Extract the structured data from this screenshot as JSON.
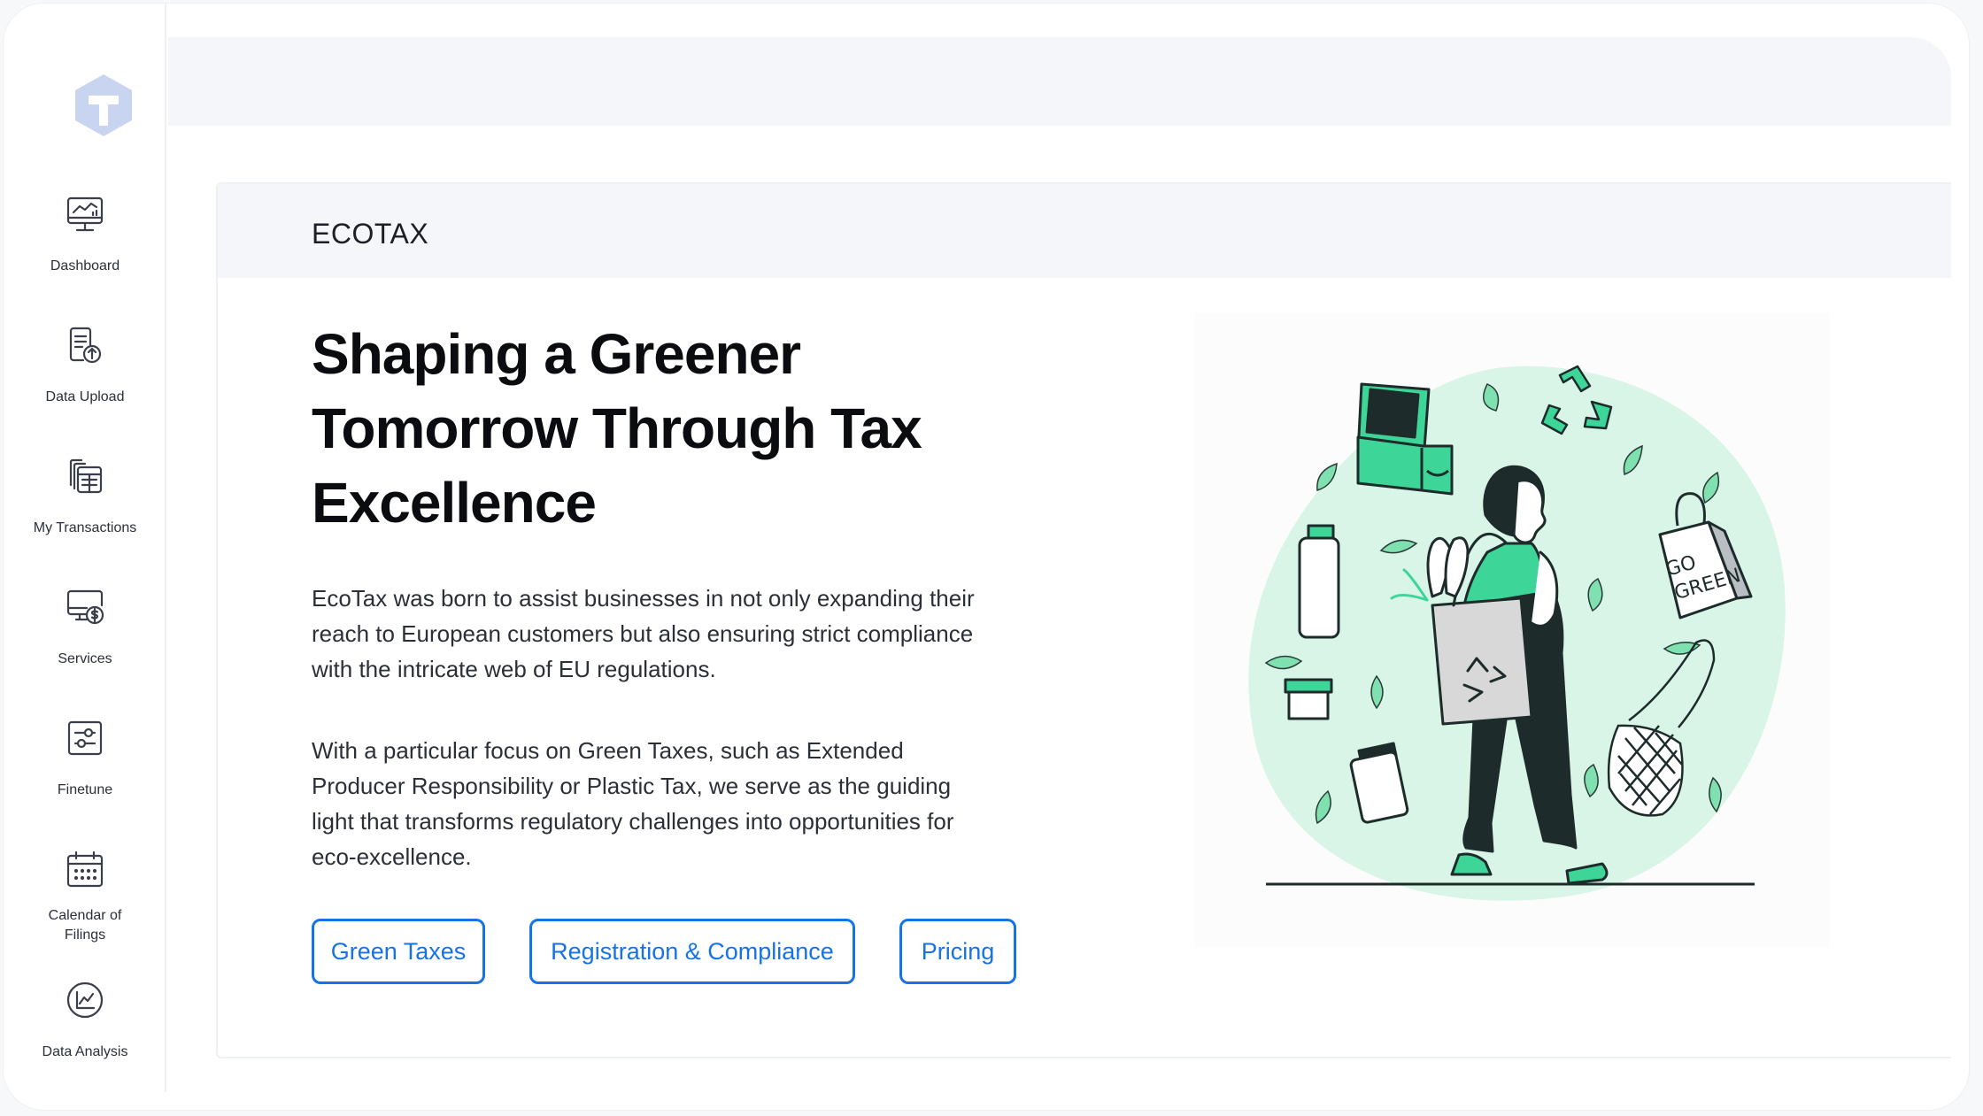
{
  "sidebar": {
    "items": [
      {
        "label": "Dashboard",
        "icon": "monitor-chart-icon"
      },
      {
        "label": "Data Upload",
        "icon": "document-upload-icon"
      },
      {
        "label": "My Transactions",
        "icon": "files-table-icon"
      },
      {
        "label": "Services",
        "icon": "monitor-dollar-icon"
      },
      {
        "label": "Finetune",
        "icon": "sliders-icon"
      },
      {
        "label": "Calendar of\nFilings",
        "label_line1": "Calendar of",
        "label_line2": "Filings",
        "icon": "calendar-icon"
      },
      {
        "label": "Data Analysis",
        "icon": "analytics-circle-icon"
      }
    ]
  },
  "card": {
    "title": "ECOTAX",
    "headline": "Shaping a Greener Tomorrow Through Tax Excellence",
    "paragraph1": "EcoTax was born to assist businesses in not only expanding their reach to European customers but also ensuring strict compliance with the intricate web of EU regulations.",
    "paragraph2": "With a particular focus on Green Taxes, such as Extended Producer Responsibility or Plastic Tax, we serve as the guiding light that transforms regulatory challenges into opportunities for eco-excellence.",
    "buttons": {
      "green_taxes": "Green Taxes",
      "registration": "Registration & Compliance",
      "pricing": "Pricing"
    },
    "illustration_text": "GO GREEN"
  },
  "colors": {
    "accent": "#1673e6",
    "green": "#3dd598",
    "green_light": "#d8f5e8",
    "icon_gray": "#4b5563",
    "logo": "#c9d5f0"
  }
}
